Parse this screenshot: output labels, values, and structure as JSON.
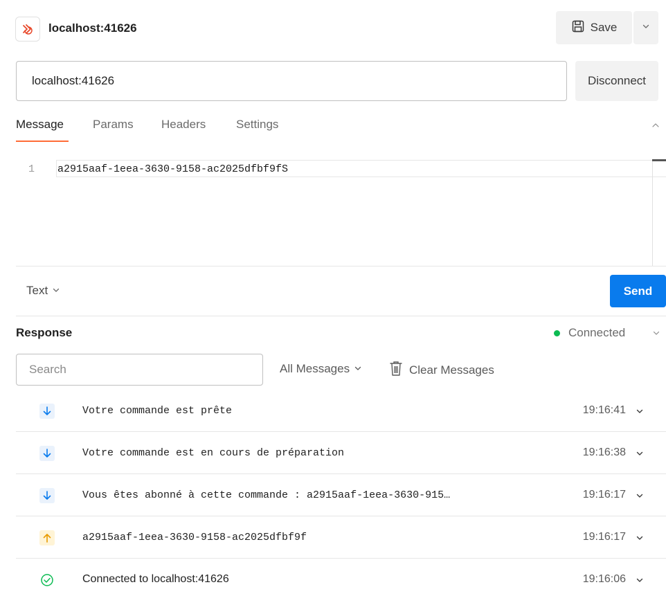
{
  "header": {
    "title": "localhost:41626",
    "save_label": "Save"
  },
  "url_bar": {
    "value": "localhost:41626",
    "disconnect_label": "Disconnect"
  },
  "tabs": [
    {
      "label": "Message",
      "active": true
    },
    {
      "label": "Params",
      "active": false
    },
    {
      "label": "Headers",
      "active": false
    },
    {
      "label": "Settings",
      "active": false
    }
  ],
  "editor": {
    "line_number": "1",
    "content": "a2915aaf-1eea-3630-9158-ac2025dfbf9fS"
  },
  "composer": {
    "format_label": "Text",
    "send_label": "Send"
  },
  "response": {
    "title": "Response",
    "status": "Connected",
    "status_color": "#0cbb52",
    "search_placeholder": "Search",
    "filter_label": "All Messages",
    "clear_label": "Clear Messages"
  },
  "messages": [
    {
      "direction": "incoming",
      "icon": "arrow-down-icon",
      "text": "Votre commande est prête",
      "time": "19:16:41"
    },
    {
      "direction": "incoming",
      "icon": "arrow-down-icon",
      "text": "Votre commande est en cours de préparation",
      "time": "19:16:38"
    },
    {
      "direction": "incoming",
      "icon": "arrow-down-icon",
      "text": "Vous êtes abonné à cette commande : a2915aaf-1eea-3630-915…",
      "time": "19:16:17"
    },
    {
      "direction": "outgoing",
      "icon": "arrow-up-icon",
      "text": "a2915aaf-1eea-3630-9158-ac2025dfbf9f",
      "time": "19:16:17"
    },
    {
      "direction": "system",
      "icon": "check-circle-icon",
      "text": "Connected to localhost:41626",
      "time": "19:16:06"
    }
  ],
  "colors": {
    "accent": "#ff6c37",
    "send": "#097bed",
    "incoming_arrow": "#097bed",
    "outgoing_arrow": "#e89b00",
    "connected_check": "#0cbb52"
  }
}
